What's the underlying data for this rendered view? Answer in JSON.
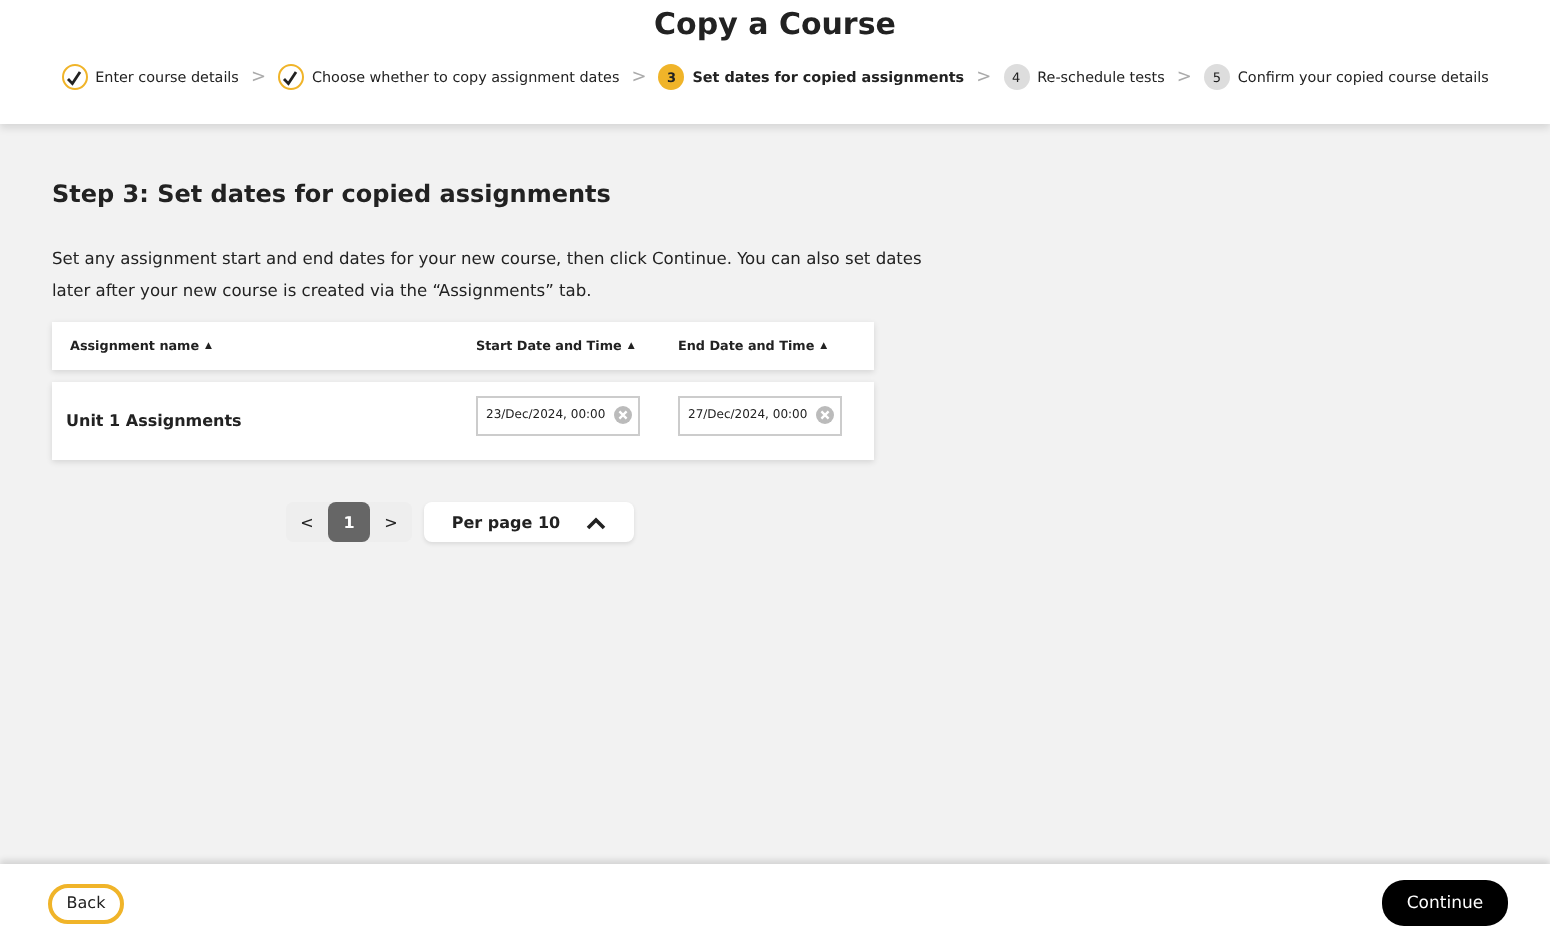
{
  "header": {
    "title": "Copy a Course"
  },
  "steps": [
    {
      "kind": "done",
      "label": "Enter course details"
    },
    {
      "kind": "done",
      "label": "Choose whether to copy assignment dates"
    },
    {
      "kind": "current",
      "number": "3",
      "label": "Set dates for copied assignments"
    },
    {
      "kind": "todo",
      "number": "4",
      "label": "Re-schedule tests"
    },
    {
      "kind": "todo",
      "number": "5",
      "label": "Confirm your copied course details"
    }
  ],
  "step_separator": ">",
  "heading": "Step 3: Set dates for copied assignments",
  "intro": "Set any assignment start and end dates for your new course, then click Continue. You can also set dates later after your new course is created via the “Assignments” tab.",
  "table": {
    "columns": [
      {
        "label": "Assignment name",
        "sort": "▲"
      },
      {
        "label": "Start Date and Time",
        "sort": "▲"
      },
      {
        "label": "End Date and Time",
        "sort": "▲"
      }
    ],
    "rows": [
      {
        "name": "Unit 1 Assignments",
        "start": "23/Dec/2024, 00:00",
        "end": "27/Dec/2024, 00:00"
      }
    ]
  },
  "pagination": {
    "prev": "<",
    "pages": [
      {
        "label": "1",
        "selected": true
      }
    ],
    "next": ">",
    "per_page": "Per page 10"
  },
  "footer": {
    "back": "Back",
    "continue": "Continue"
  }
}
